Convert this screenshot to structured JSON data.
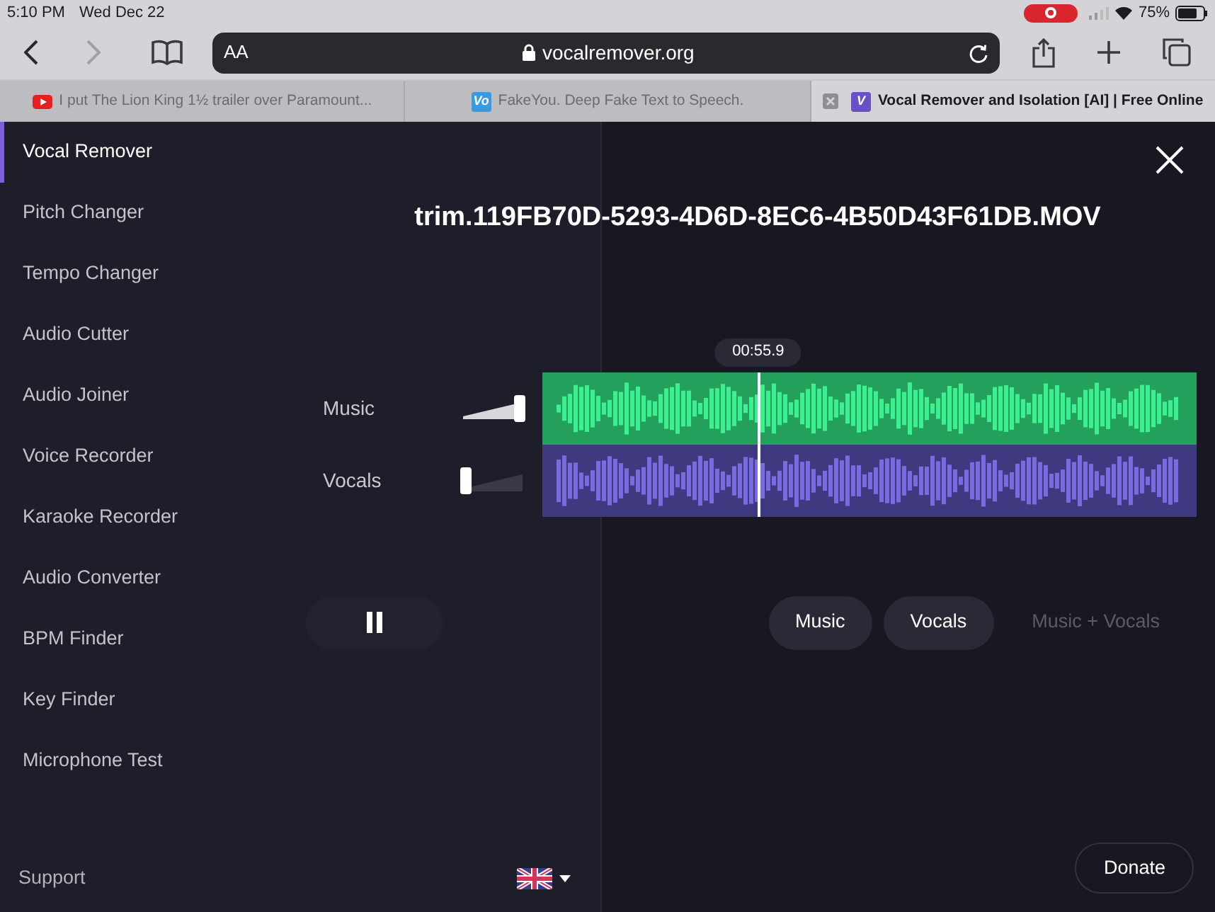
{
  "status_bar": {
    "time": "5:10 PM",
    "date": "Wed Dec 22",
    "battery": "75%"
  },
  "toolbar": {
    "back_enabled": true,
    "forward_enabled": false,
    "text_size": "AA",
    "url": "vocalremover.org"
  },
  "tabs": [
    {
      "label": "I put The Lion King 1½ trailer over Paramount...",
      "kind": "video",
      "selected": false
    },
    {
      "label": "FakeYou. Deep Fake Text to Speech.",
      "kind": "letter",
      "favicon_text": "Vo",
      "color": "#3a9ae0",
      "selected": false
    },
    {
      "label": "Vocal Remover and Isolation [AI] | Free Online",
      "kind": "letter",
      "favicon_text": "V",
      "color": "#6a4fc8",
      "selected": true
    }
  ],
  "sidebar": {
    "items": [
      {
        "label": "Vocal Remover",
        "selected": true
      },
      {
        "label": "Pitch Changer",
        "selected": false
      },
      {
        "label": "Tempo Changer",
        "selected": false
      },
      {
        "label": "Audio Cutter",
        "selected": false
      },
      {
        "label": "Audio Joiner",
        "selected": false
      },
      {
        "label": "Voice Recorder",
        "selected": false
      },
      {
        "label": "Karaoke Recorder",
        "selected": false
      },
      {
        "label": "Audio Converter",
        "selected": false
      },
      {
        "label": "BPM Finder",
        "selected": false
      },
      {
        "label": "Key Finder",
        "selected": false
      },
      {
        "label": "Microphone Test",
        "selected": false
      }
    ],
    "footer_link": "Support"
  },
  "editor": {
    "file_name": "trim.119FB70D-5293-4D6D-8EC6-4B50D43F61DB.MOV",
    "playhead": {
      "time": "00:55.9",
      "level": 0.33
    },
    "tracks": [
      {
        "name": "Music",
        "level": 1,
        "color": "#22a05c"
      },
      {
        "name": "Vocals",
        "level": 0,
        "color": "#3f3a80"
      }
    ],
    "playing": true,
    "downloads": [
      {
        "label": "Music",
        "disabled": false
      },
      {
        "label": "Vocals",
        "disabled": false
      },
      {
        "label": "Music + Vocals",
        "disabled": true
      }
    ],
    "donate": "Donate"
  }
}
